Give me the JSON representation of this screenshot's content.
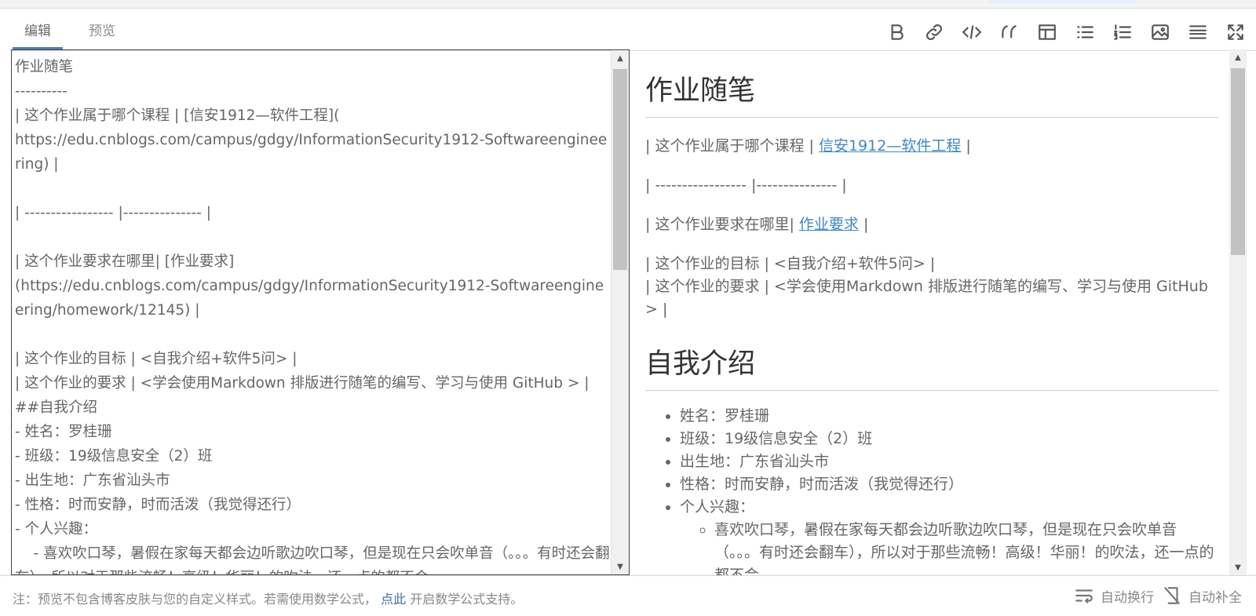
{
  "tabs": {
    "edit": "编辑",
    "preview": "预览"
  },
  "toolbar": {
    "icons": [
      "bold-icon",
      "link-icon",
      "code-icon",
      "quote-icon",
      "table-icon",
      "bullet-list-icon",
      "numbered-list-icon",
      "image-icon",
      "hr-icon",
      "fullscreen-icon"
    ]
  },
  "editor": {
    "text": "作业随笔\n----------\n| 这个作业属于哪个课程 | [信安1912—软件工程](\nhttps://edu.cnblogs.com/campus/gdgy/InformationSecurity1912-Softwareengineering) |\n\n| ----------------- |--------------- |\n\n| 这个作业要求在哪里| [作业要求]\n(https://edu.cnblogs.com/campus/gdgy/InformationSecurity1912-Softwareengineering/homework/12145) |\n\n| 这个作业的目标 | <自我介绍+软件5问> |\n| 这个作业的要求 | <学会使用Markdown 排版进行随笔的编写、学习与使用 GitHub > |\n##自我介绍\n- 姓名：罗桂珊\n- 班级：19级信息安全（2）班\n- 出生地：广东省汕头市\n- 性格：时而安静，时而活泼（我觉得还行）\n- 个人兴趣：\n    - 喜欢吹口琴，暑假在家每天都会边听歌边吹口琴，但是现在只会吹单音（。。。有时还会翻车），所以对于那些流畅！高级！华丽！的吹法，还一点的都不会"
  },
  "preview": {
    "h1_title": "作业随笔",
    "row1_prefix": "| 这个作业属于哪个课程 | ",
    "row1_link": "信安1912—软件工程",
    "row1_suffix": " |",
    "sep_row": "| ----------------- |--------------- |",
    "row2_prefix": "| 这个作业要求在哪里| ",
    "row2_link": "作业要求",
    "row2_suffix": " |",
    "row3": "| 这个作业的目标 | <自我介绍+软件5问> |",
    "row4": "| 这个作业的要求 | <学会使用Markdown 排版进行随笔的编写、学习与使用 GitHub > |",
    "h1_intro": "自我介绍",
    "list": [
      "姓名：罗桂珊",
      "班级：19级信息安全（2）班",
      "出生地：广东省汕头市",
      "性格：时而安静，时而活泼（我觉得还行）",
      "个人兴趣："
    ],
    "sublist": [
      "喜欢吹口琴，暑假在家每天都会边听歌边吹口琴，但是现在只会吹单音（。。。有时还会翻车），所以对于那些流畅！高级！华丽！的吹法，还一点的都不会"
    ]
  },
  "footer": {
    "note_prefix": "注：预览不包含博客皮肤与您的自定义样式。若需使用数学公式，",
    "note_link": "点此",
    "note_suffix": " 开启数学公式支持。",
    "wrap_label": "自动换行",
    "complete_label": "自动补全"
  }
}
